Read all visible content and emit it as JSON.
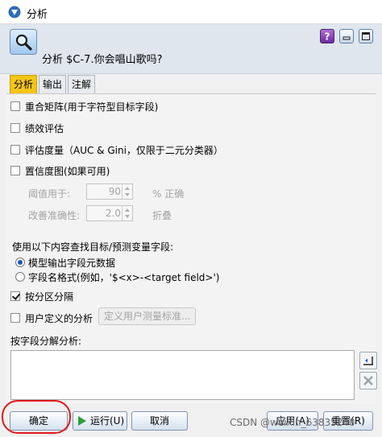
{
  "window": {
    "title": "分析"
  },
  "header": {
    "node_label": "分析 $C-7.你会唱山歌吗?"
  },
  "tabs": [
    {
      "label": "分析"
    },
    {
      "label": "输出"
    },
    {
      "label": "注解"
    }
  ],
  "options": {
    "coincidence": "重合矩阵(用于字符型目标字段)",
    "performance": "绩效评估",
    "evaluation": "评估度量（AUC & Gini，仅限于二元分类器）",
    "confidence": "置信度图(如果可用)",
    "threshold_label": "阈值用于:",
    "threshold_value": "90",
    "threshold_unit": "% 正确",
    "improve_label": "改善准确性:",
    "improve_value": "2.0",
    "improve_unit": "折叠"
  },
  "field_find": {
    "label": "使用以下内容查找目标/预测变量字段:",
    "model_meta": "模型输出字段元数据",
    "name_format": "字段名格式(例如，'$<x>-<target field>')"
  },
  "partition": "按分区分隔",
  "user_defined": {
    "label": "用户定义的分析",
    "button": "定义用户测量标准..."
  },
  "break_down": "按字段分解分析:",
  "footer": {
    "ok": "确定",
    "run": "运行(U)",
    "cancel": "取消",
    "apply": "应用(A)",
    "reset": "重置(R)"
  },
  "watermark": "CSDN @weixin_63835240",
  "colors": {
    "active_tab": "#f5c518",
    "highlight_ring": "#e01b1b",
    "help_button": "#7a34a8"
  }
}
